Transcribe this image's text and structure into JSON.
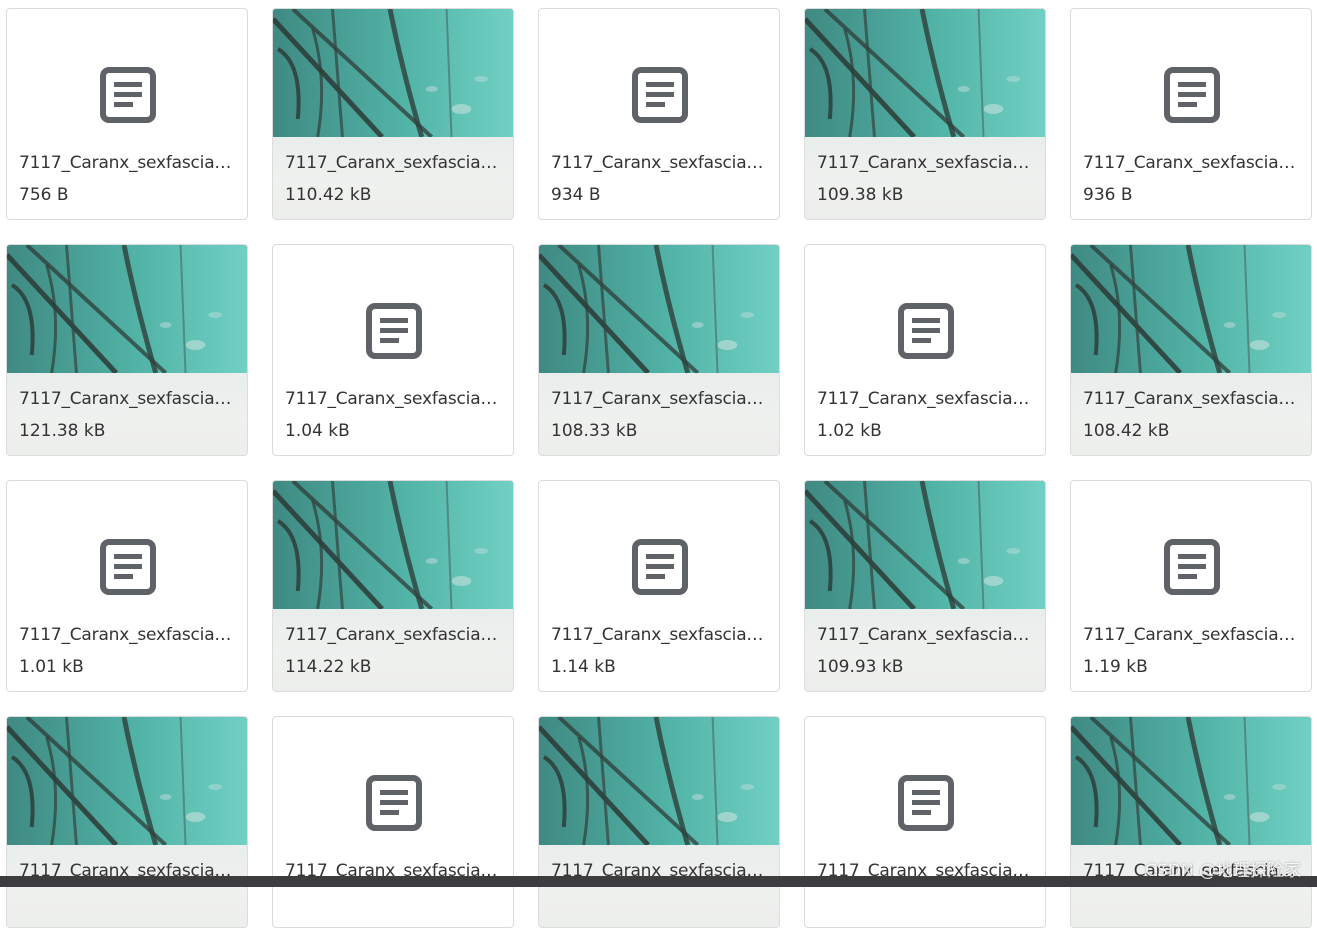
{
  "files": [
    {
      "name": "7117_Caranx_sexfasciat...",
      "size": "756 B",
      "kind": "doc"
    },
    {
      "name": "7117_Caranx_sexfasciat...",
      "size": "110.42 kB",
      "kind": "image"
    },
    {
      "name": "7117_Caranx_sexfasciat...",
      "size": "934 B",
      "kind": "doc"
    },
    {
      "name": "7117_Caranx_sexfasciat...",
      "size": "109.38 kB",
      "kind": "image"
    },
    {
      "name": "7117_Caranx_sexfasciat...",
      "size": "936 B",
      "kind": "doc"
    },
    {
      "name": "7117_Caranx_sexfasciat...",
      "size": "121.38 kB",
      "kind": "image"
    },
    {
      "name": "7117_Caranx_sexfasciat...",
      "size": "1.04 kB",
      "kind": "doc"
    },
    {
      "name": "7117_Caranx_sexfasciat...",
      "size": "108.33 kB",
      "kind": "image"
    },
    {
      "name": "7117_Caranx_sexfasciat...",
      "size": "1.02 kB",
      "kind": "doc"
    },
    {
      "name": "7117_Caranx_sexfasciat...",
      "size": "108.42 kB",
      "kind": "image"
    },
    {
      "name": "7117_Caranx_sexfasciat...",
      "size": "1.01 kB",
      "kind": "doc"
    },
    {
      "name": "7117_Caranx_sexfasciat...",
      "size": "114.22 kB",
      "kind": "image"
    },
    {
      "name": "7117_Caranx_sexfasciat...",
      "size": "1.14 kB",
      "kind": "doc"
    },
    {
      "name": "7117_Caranx_sexfasciat...",
      "size": "109.93 kB",
      "kind": "image"
    },
    {
      "name": "7117_Caranx_sexfasciat...",
      "size": "1.19 kB",
      "kind": "doc"
    },
    {
      "name": "7117_Caranx_sexfasciat...",
      "size": "",
      "kind": "image"
    },
    {
      "name": "7117_Caranx_sexfasciat...",
      "size": "",
      "kind": "doc"
    },
    {
      "name": "7117_Caranx_sexfasciat...",
      "size": "",
      "kind": "image"
    },
    {
      "name": "7117_Caranx_sexfasciat...",
      "size": "",
      "kind": "doc"
    },
    {
      "name": "7117_Caranx_sexfasciat...",
      "size": "",
      "kind": "image"
    }
  ],
  "icons": {
    "document": "document-icon",
    "image": "underwater-photo-thumbnail"
  },
  "colors": {
    "icon": "#5f6368",
    "water": "#4fb3a8",
    "border": "#dcdcdc",
    "text": "#333333"
  },
  "watermark": "CSDN @地理探险家"
}
